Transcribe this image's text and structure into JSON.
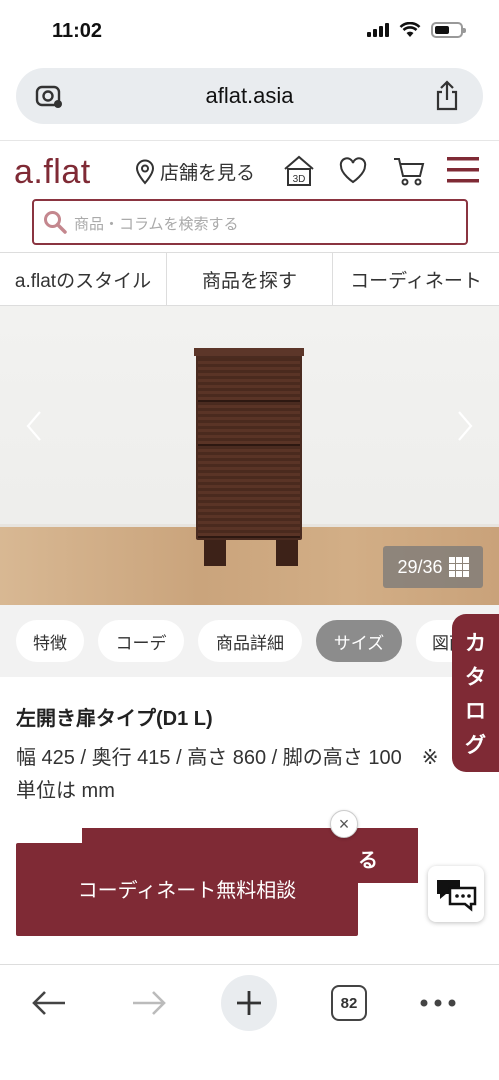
{
  "status_bar": {
    "time": "11:02"
  },
  "browser": {
    "url": "aflat.asia",
    "tab_count": "82"
  },
  "header": {
    "logo": "a.flat",
    "store_link": "店舗を見る",
    "icon_3d_label": "3D",
    "search_placeholder": "商品・コラムを検索する"
  },
  "nav_tabs": [
    {
      "label": "a.flatのスタイル"
    },
    {
      "label": "商品を探す"
    },
    {
      "label": "コーディネート"
    }
  ],
  "hero": {
    "counter": "29/36"
  },
  "section_tabs": [
    {
      "label": "特徴"
    },
    {
      "label": "コーデ"
    },
    {
      "label": "商品詳細"
    },
    {
      "label": "サイズ",
      "active": true
    },
    {
      "label": "図面"
    }
  ],
  "catalog_tab": [
    "カ",
    "タ",
    "ロ",
    "グ"
  ],
  "product": {
    "title": "左開き扉タイプ(D1 L)",
    "dims": "幅 425 / 奥行 415 / 高さ 860 / 脚の高さ 100　※単位は mm"
  },
  "floating": {
    "behind_button_text": "る",
    "consult_button": "コーディネート無料相談",
    "close": "×"
  },
  "colors": {
    "brand": "#7f2a35",
    "active_tab": "#8c8c8c"
  }
}
